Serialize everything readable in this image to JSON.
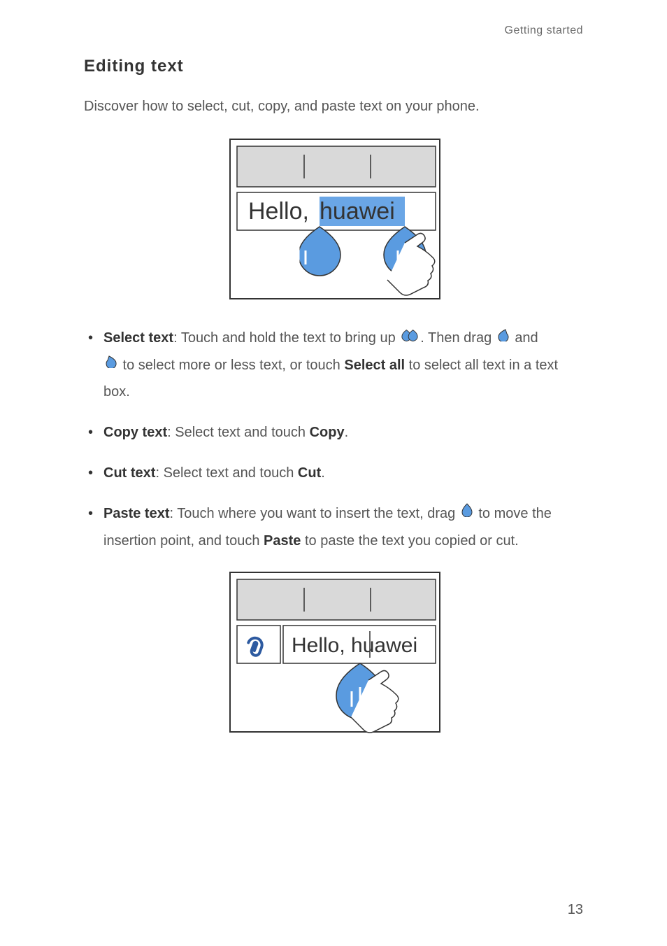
{
  "header": {
    "running_head": "Getting started"
  },
  "section": {
    "title": "Editing  text"
  },
  "intro": "Discover how to select, cut, copy, and paste text on your phone.",
  "figures": {
    "select_text_phrase": "Hello, ",
    "select_text_highlight": "huawei",
    "paste_text_phrase": "Hello, huawei"
  },
  "steps": {
    "select": {
      "lead": "Select text",
      "part1": ": Touch and hold the text to bring up ",
      "part2": ". Then drag ",
      "part3": " and",
      "part4": " to select more or less text, or touch ",
      "select_all": "Select all",
      "part5": " to select all text in a text box."
    },
    "copy": {
      "lead": "Copy text",
      "rest1": ": Select text and touch ",
      "action": "Copy",
      "rest2": "."
    },
    "cut": {
      "lead": "Cut text",
      "rest1": ": Select text and touch ",
      "action": "Cut",
      "rest2": "."
    },
    "paste": {
      "lead": "Paste text",
      "part1": ": Touch where you want to insert the text, drag ",
      "part2": " to move the insertion point, and touch ",
      "action": "Paste",
      "part3": " to paste the text you copied or cut."
    }
  },
  "page_number": "13"
}
